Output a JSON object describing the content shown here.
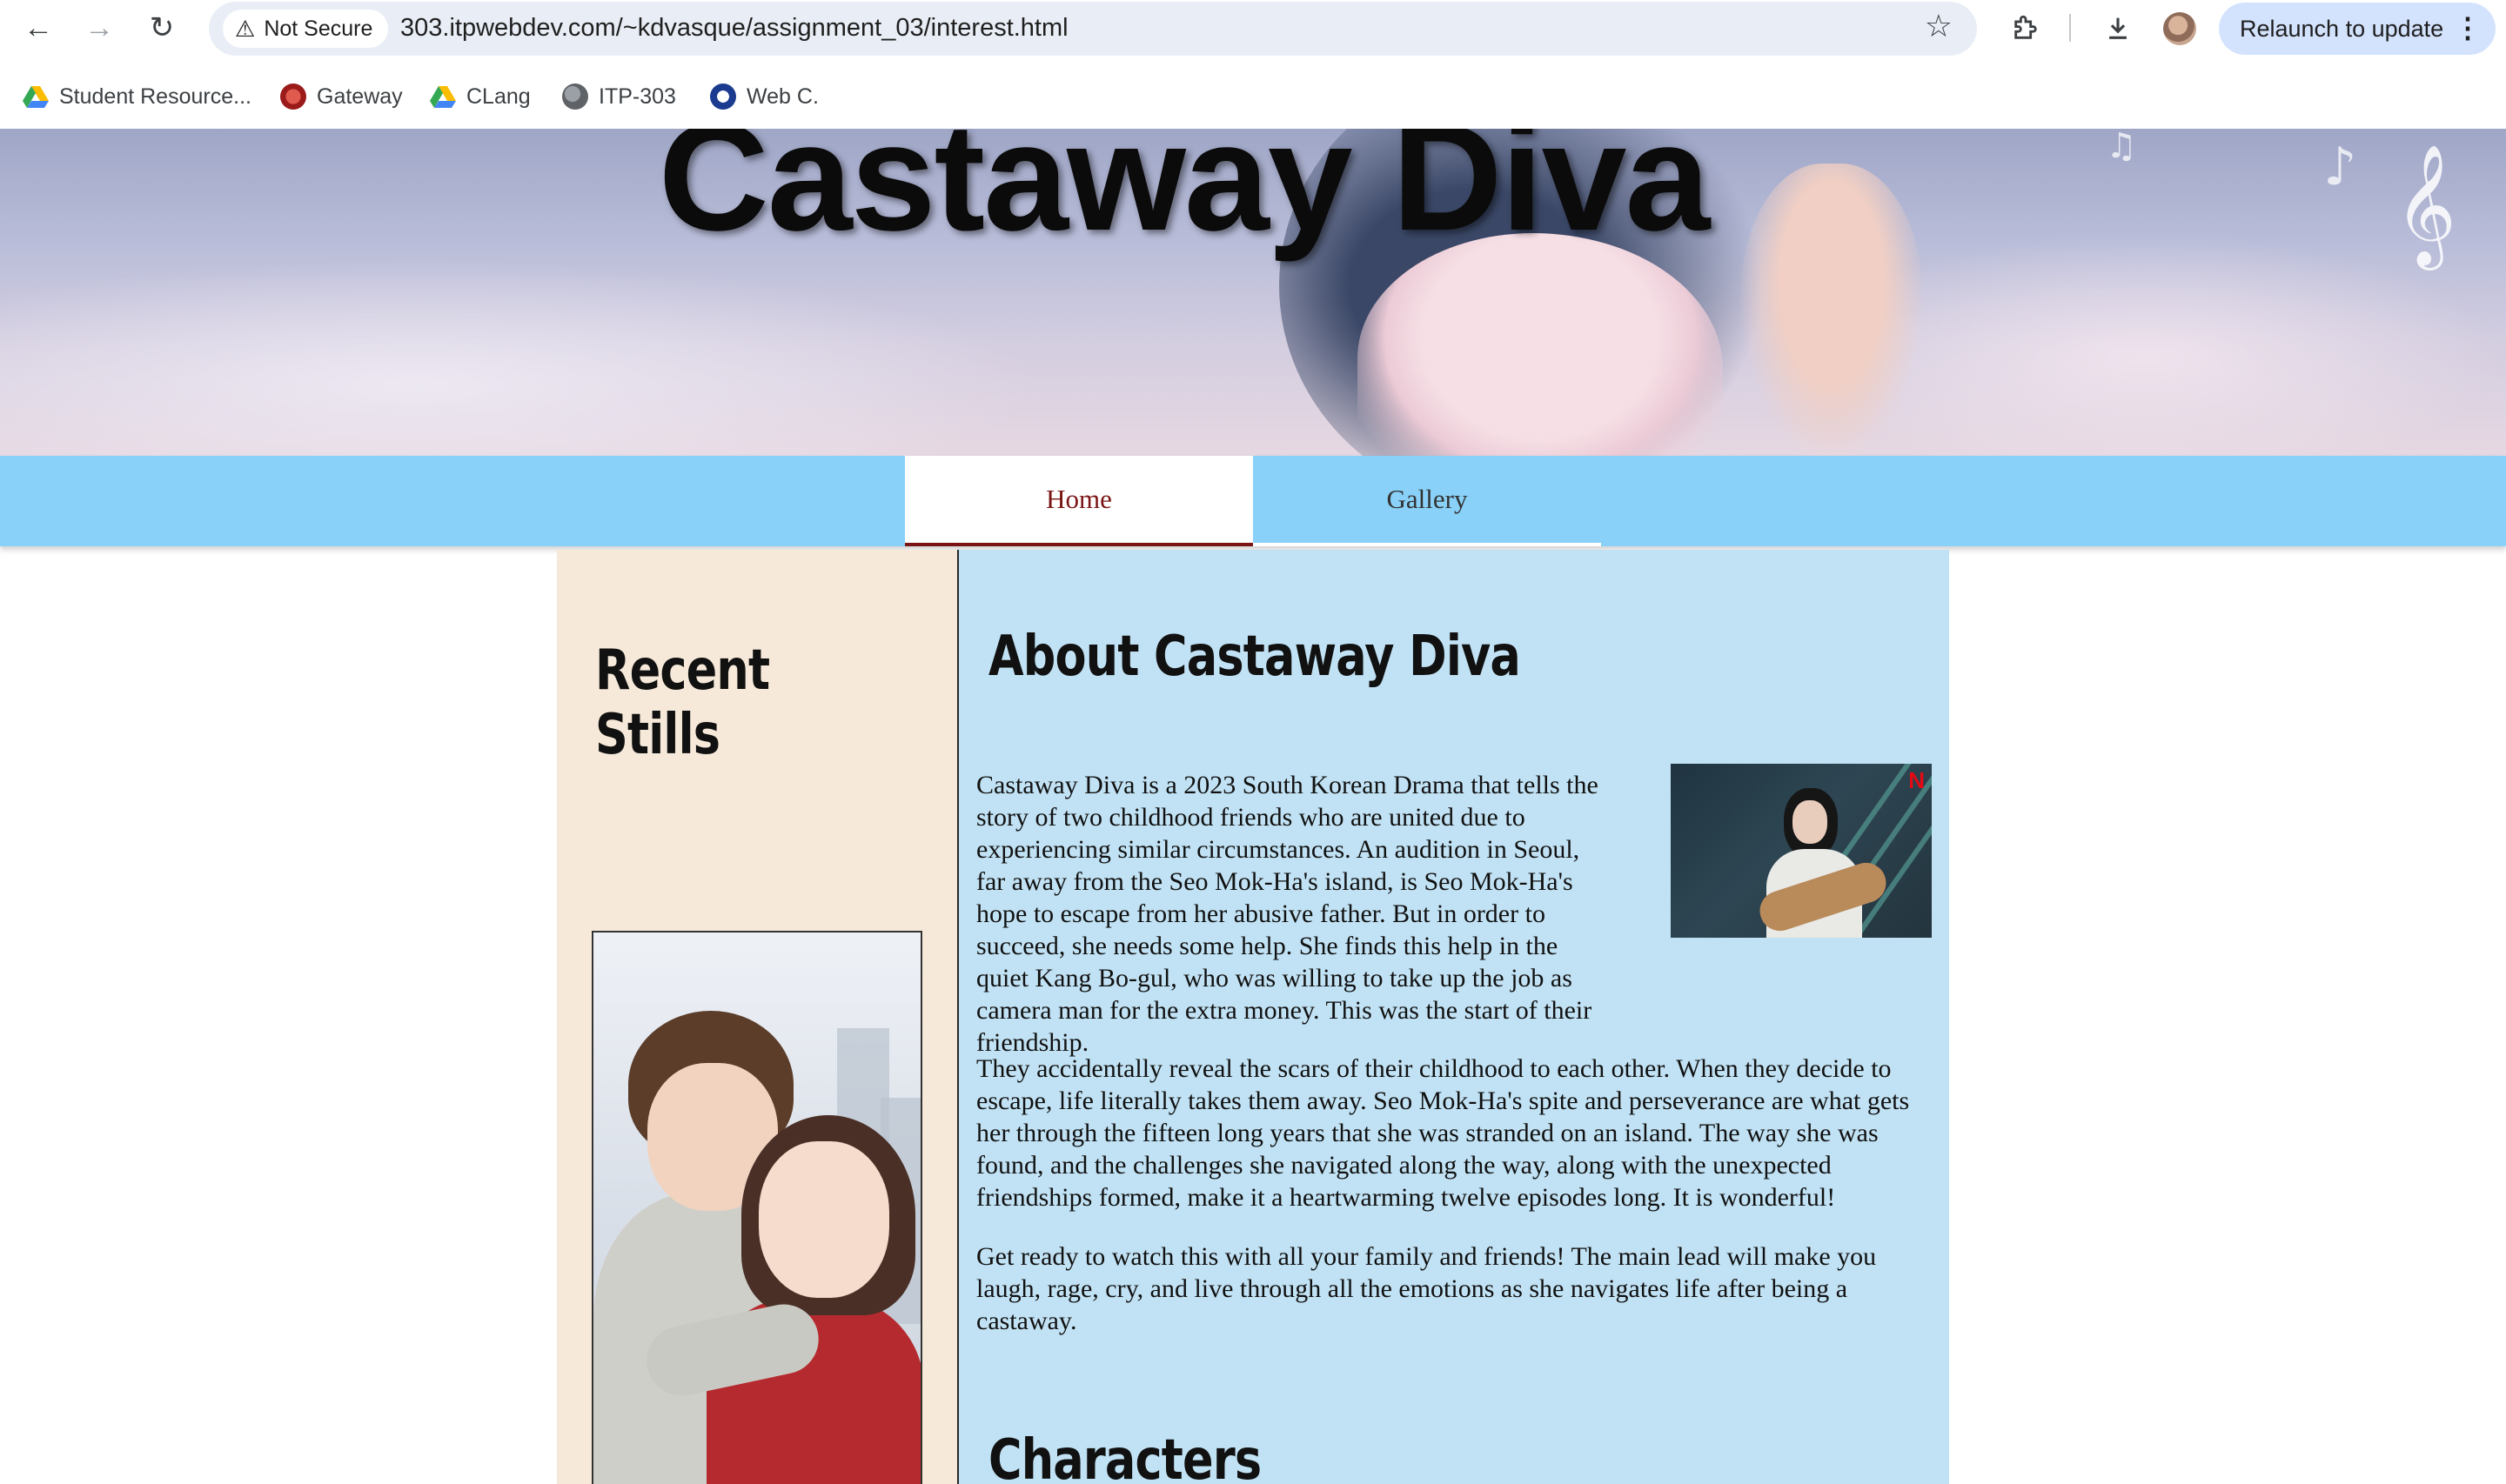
{
  "browser": {
    "security_label": "Not Secure",
    "url": "303.itpwebdev.com/~kdvasque/assignment_03/interest.html",
    "relaunch_label": "Relaunch to update",
    "bookmarks": [
      {
        "label": "Student Resource...",
        "icon": "google-drive-icon"
      },
      {
        "label": "Gateway",
        "icon": "gateway-icon"
      },
      {
        "label": "CLang",
        "icon": "google-drive-icon"
      },
      {
        "label": "ITP-303",
        "icon": "globe-icon"
      },
      {
        "label": "Web C.",
        "icon": "circle-icon"
      }
    ]
  },
  "site": {
    "title": "Castaway Diva",
    "nav": [
      {
        "label": "Home",
        "active": true
      },
      {
        "label": "Gallery",
        "active": false
      }
    ]
  },
  "sidebar": {
    "title": "Recent Stills"
  },
  "main": {
    "about_title": "About Castaway Diva",
    "paragraphs": [
      "Castaway Diva is a 2023 South Korean Drama that tells the story of two childhood friends who are united due to experiencing similar circumstances. An audition in Seoul, far away from the Seo Mok-Ha's island, is Seo Mok-Ha's hope to escape from her abusive father. But in order to succeed, she needs some help. She finds this help in the quiet Kang Bo-gul, who was willing to take up the job as camera man for the extra money. This was the start of their friendship.",
      "They accidentally reveal the scars of their childhood to each other. When they decide to escape, life literally takes them away. Seo Mok-Ha's spite and perseverance are what gets her through the fifteen long years that she was stranded on an island. The way she was found, and the challenges she navigated along the way, along with the unexpected friendships formed, make it a heartwarming twelve episodes long. It is wonderful!",
      "Get ready to watch this with all your family and friends! The main lead will make you laugh, rage, cry, and live through all the emotions as she navigates life after being a castaway."
    ],
    "characters_title": "Characters",
    "photo_badge": "N"
  },
  "colors": {
    "nav_bg": "#89d1f8",
    "sidebar_bg": "#f6e9d9",
    "main_bg": "#c1e2f4",
    "active_tab_text": "#7a1414"
  }
}
